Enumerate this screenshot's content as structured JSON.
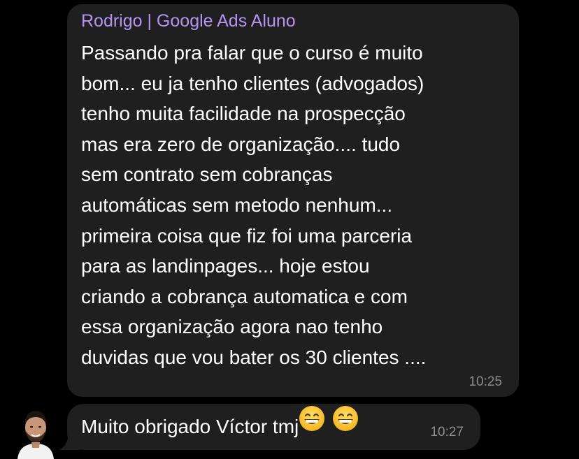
{
  "messages": [
    {
      "sender": "Rodrigo | Google Ads Aluno",
      "lines": [
        "Passando pra falar que o curso é muito",
        "bom... eu ja tenho clientes (advogados)",
        "tenho muita facilidade na prospecção",
        "mas era zero de organização.... tudo",
        "sem contrato sem cobranças",
        "automáticas sem metodo nenhum...",
        "primeira coisa que fiz foi uma parceria",
        "para as landinpages... hoje estou",
        "criando a cobrança automatica e com",
        "essa organização agora nao tenho",
        "duvidas que vou bater os 30 clientes ...."
      ],
      "time": "10:25"
    },
    {
      "text": "Muito obrigado Víctor tmj",
      "emojis": [
        "grinning-face-with-smiling-eyes",
        "grinning-face-with-smiling-eyes"
      ],
      "time": "10:27"
    }
  ],
  "colors": {
    "background": "#000000",
    "bubble": "#1f1f1f",
    "sender_name": "#b493f2",
    "message_text": "#ffffff",
    "timestamp": "#8e8e93"
  }
}
